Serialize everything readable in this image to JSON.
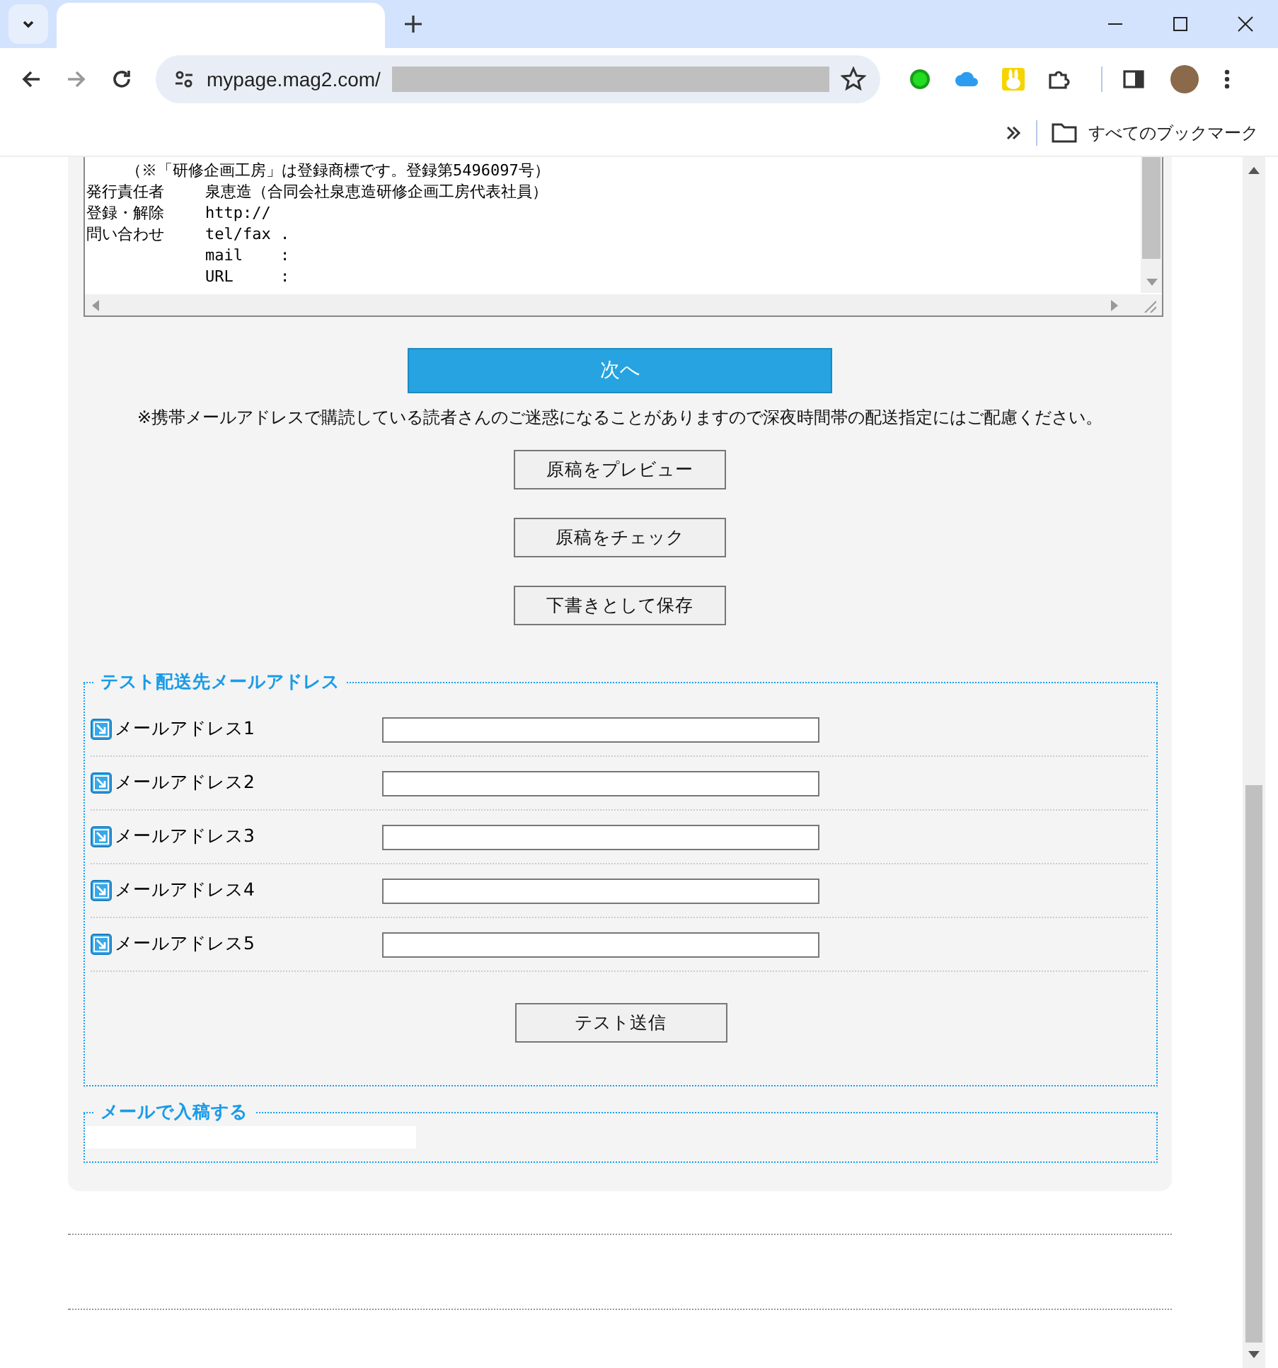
{
  "browser": {
    "url": "mypage.mag2.com/",
    "bookmarks_label": "すべてのブックマーク"
  },
  "draft_lines": [
    {
      "value": "（※「研修企画工房」は登録商標です。登録第5496097号）"
    },
    {
      "label": "発行責任者",
      "value": "泉恵造（合同会社泉恵造研修企画工房代表社員）"
    },
    {
      "label": "登録・解除",
      "value": "http://"
    },
    {
      "label": "問い合わせ",
      "value": "tel/fax ."
    },
    {
      "value": "mail    :"
    },
    {
      "value": "URL     :"
    }
  ],
  "next_button": "次へ",
  "notice": "※携帯メールアドレスで購読している読者さんのご迷惑になることがありますので深夜時間帯の配送指定にはご配慮ください。",
  "buttons": [
    "原稿をプレビュー",
    "原稿をチェック",
    "下書きとして保存"
  ],
  "test_section": {
    "legend": "テスト配送先メールアドレス",
    "fields": [
      {
        "label": "メールアドレス1"
      },
      {
        "label": "メールアドレス2"
      },
      {
        "label": "メールアドレス3"
      },
      {
        "label": "メールアドレス4"
      },
      {
        "label": "メールアドレス5"
      }
    ],
    "send_button": "テスト送信"
  },
  "mail_section": {
    "legend": "メールで入稿する"
  }
}
